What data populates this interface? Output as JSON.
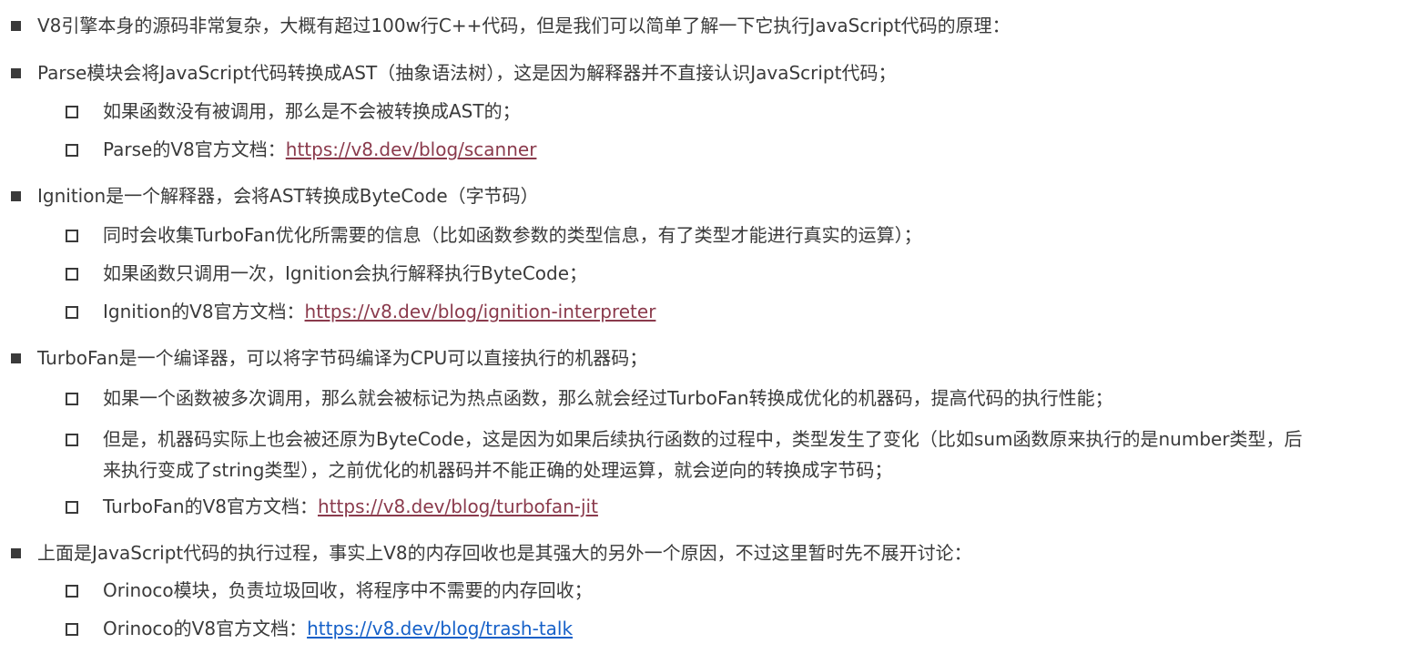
{
  "items": [
    {
      "text": "V8引擎本身的源码非常复杂，大概有超过100w行C++代码，但是我们可以简单了解一下它执行JavaScript代码的原理：",
      "children": []
    },
    {
      "text": "Parse模块会将JavaScript代码转换成AST（抽象语法树），这是因为解释器并不直接认识JavaScript代码；",
      "children": [
        {
          "text": "如果函数没有被调用，那么是不会被转换成AST的；"
        },
        {
          "text": "Parse的V8官方文档：",
          "link": "https://v8.dev/blog/scanner"
        }
      ]
    },
    {
      "text": "Ignition是一个解释器，会将AST转换成ByteCode（字节码）",
      "children": [
        {
          "text": "同时会收集TurboFan优化所需要的信息（比如函数参数的类型信息，有了类型才能进行真实的运算）；"
        },
        {
          "text": "如果函数只调用一次，Ignition会执行解释执行ByteCode；"
        },
        {
          "text": "Ignition的V8官方文档：",
          "link": "https://v8.dev/blog/ignition-interpreter"
        }
      ]
    },
    {
      "text": "TurboFan是一个编译器，可以将字节码编译为CPU可以直接执行的机器码；",
      "children": [
        {
          "text": "如果一个函数被多次调用，那么就会被标记为热点函数，那么就会经过TurboFan转换成优化的机器码，提高代码的执行性能；"
        },
        {
          "text_line1": "但是，机器码实际上也会被还原为ByteCode，这是因为如果后续执行函数的过程中，类型发生了变化（比如sum函数原来执行的是number类型，后",
          "text_line2": "来执行变成了string类型），之前优化的机器码并不能正确的处理运算，就会逆向的转换成字节码；"
        },
        {
          "text": "TurboFan的V8官方文档：",
          "link": "https://v8.dev/blog/turbofan-jit"
        }
      ]
    },
    {
      "text": "上面是JavaScript代码的执行过程，事实上V8的内存回收也是其强大的另外一个原因，不过这里暂时先不展开讨论：",
      "children": [
        {
          "text": "Orinoco模块，负责垃圾回收，将程序中不需要的内存回收；"
        },
        {
          "text": "Orinoco的V8官方文档：",
          "link": "https://v8.dev/blog/trash-talk"
        }
      ]
    }
  ]
}
